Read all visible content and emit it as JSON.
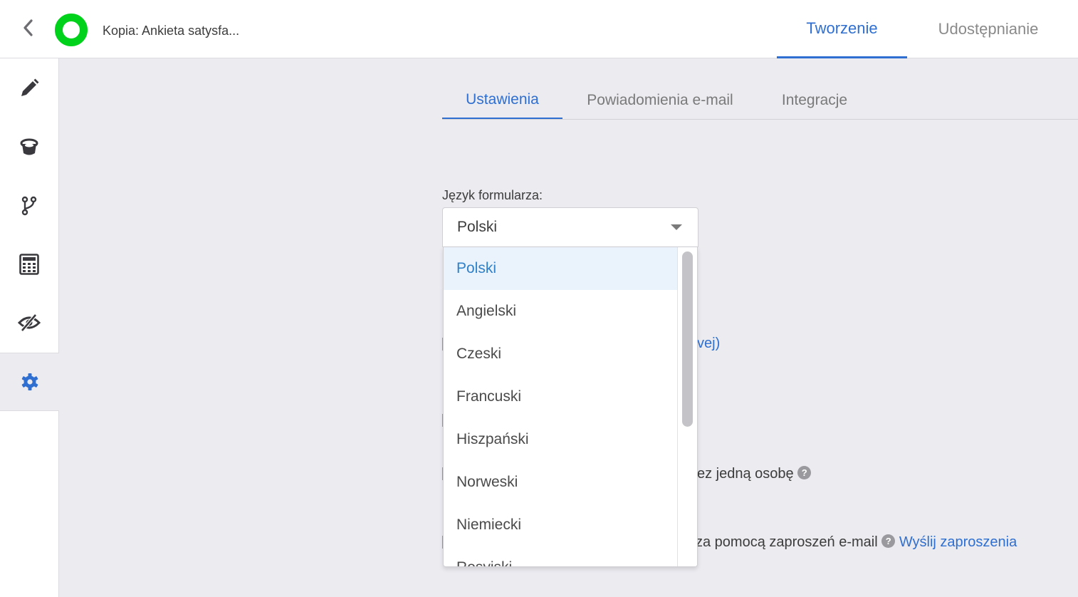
{
  "header": {
    "form_title": "Kopia: Ankieta satysfa...",
    "tabs": [
      {
        "label": "Tworzenie",
        "active": true
      },
      {
        "label": "Udostępnianie",
        "active": false
      }
    ],
    "logo_color": "#00d11a"
  },
  "sidebar": {
    "items": [
      {
        "icon": "pencil-icon",
        "active": false
      },
      {
        "icon": "paint-bucket-icon",
        "active": false
      },
      {
        "icon": "branch-icon",
        "active": false
      },
      {
        "icon": "calculator-icon",
        "active": false
      },
      {
        "icon": "eye-hidden-icon",
        "active": false
      },
      {
        "icon": "gear-icon",
        "active": true
      }
    ]
  },
  "subtabs": [
    {
      "label": "Ustawienia",
      "active": true
    },
    {
      "label": "Powiadomienia e-mail",
      "active": false
    },
    {
      "label": "Integracje",
      "active": false
    }
  ],
  "language": {
    "label": "Język formularza:",
    "selected": "Polski",
    "options": [
      "Polski",
      "Angielski",
      "Czeski",
      "Francuski",
      "Hiszpański",
      "Norweski",
      "Niemiecki",
      "Rosyjski"
    ]
  },
  "background_text": {
    "link_fragment": "vej)",
    "one_person_fragment": "ez jedną osobę",
    "invite_fragment": "za pomocą zaproszeń e-mail",
    "invite_link": "Wyślij zaproszenia"
  },
  "colors": {
    "accent": "#2e6fd1",
    "selected_option_bg": "#eaf3fb",
    "selected_option_text": "#2f80c8"
  }
}
